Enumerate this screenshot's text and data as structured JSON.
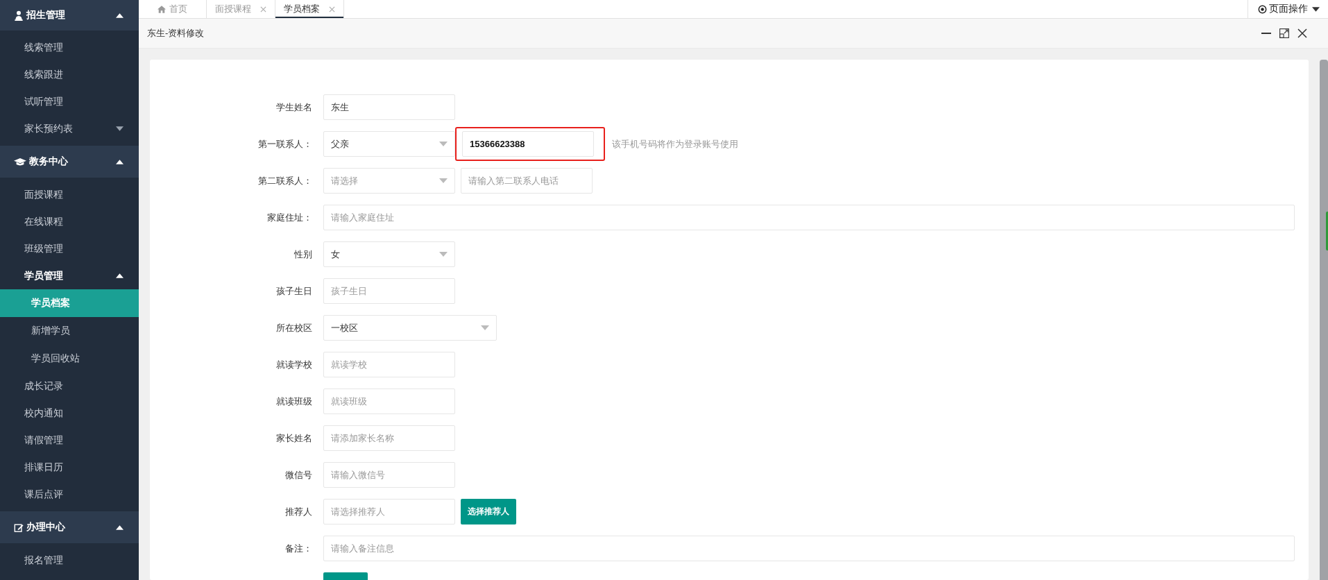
{
  "sidebar": {
    "groups": [
      {
        "label": "招生管理",
        "expanded": true,
        "items": [
          {
            "label": "线索管理",
            "kind": "link",
            "selected": false
          },
          {
            "label": "线索跟进",
            "kind": "link",
            "selected": false
          },
          {
            "label": "试听管理",
            "kind": "link",
            "selected": false
          },
          {
            "label": "家长预约表",
            "kind": "folder",
            "expanded": false,
            "selected": false
          }
        ]
      },
      {
        "label": "教务中心",
        "expanded": true,
        "items": [
          {
            "label": "面授课程",
            "kind": "link",
            "selected": false
          },
          {
            "label": "在线课程",
            "kind": "link",
            "selected": false
          },
          {
            "label": "班级管理",
            "kind": "link",
            "selected": false
          },
          {
            "label": "学员管理",
            "kind": "folder",
            "expanded": true,
            "selected": false,
            "children": [
              {
                "label": "学员档案",
                "selected": true
              },
              {
                "label": "新增学员",
                "selected": false
              },
              {
                "label": "学员回收站",
                "selected": false
              }
            ]
          },
          {
            "label": "成长记录",
            "kind": "link",
            "selected": false
          },
          {
            "label": "校内通知",
            "kind": "link",
            "selected": false
          },
          {
            "label": "请假管理",
            "kind": "link",
            "selected": false
          },
          {
            "label": "排课日历",
            "kind": "link",
            "selected": false
          },
          {
            "label": "课后点评",
            "kind": "link",
            "selected": false
          }
        ]
      },
      {
        "label": "办理中心",
        "expanded": true,
        "items": [
          {
            "label": "报名管理",
            "kind": "link",
            "selected": false
          }
        ]
      }
    ]
  },
  "tabs": [
    {
      "label": "首页",
      "kind": "home",
      "selected": false
    },
    {
      "label": "面授课程",
      "kind": "page",
      "selected": false
    },
    {
      "label": "学员档案",
      "kind": "page",
      "selected": true
    }
  ],
  "page_actions": {
    "label": "页面操作"
  },
  "panel": {
    "title": "东生-资料修改"
  },
  "form": {
    "rows": [
      {
        "label": "学生姓名",
        "controls": [
          {
            "kind": "input",
            "value": "东生"
          }
        ]
      },
      {
        "label": "第一联系人：",
        "controls": [
          {
            "kind": "select",
            "value": "父亲"
          },
          {
            "kind": "input",
            "value": "15366623388",
            "highlighted": true
          },
          {
            "kind": "hint",
            "text": "该手机号码将作为登录账号使用"
          }
        ]
      },
      {
        "label": "第二联系人：",
        "controls": [
          {
            "kind": "select",
            "placeholder": "请选择"
          },
          {
            "kind": "input",
            "placeholder": "请输入第二联系人电话"
          }
        ]
      },
      {
        "label": "家庭住址：",
        "controls": [
          {
            "kind": "wide-input",
            "placeholder": "请输入家庭住址"
          }
        ]
      },
      {
        "label": "性别",
        "controls": [
          {
            "kind": "select",
            "value": "女"
          }
        ]
      },
      {
        "label": "孩子生日",
        "controls": [
          {
            "kind": "input",
            "placeholder": "孩子生日"
          }
        ]
      },
      {
        "label": "所在校区",
        "controls": [
          {
            "kind": "wide-select",
            "value": "一校区"
          }
        ]
      },
      {
        "label": "就读学校",
        "controls": [
          {
            "kind": "input",
            "placeholder": "就读学校"
          }
        ]
      },
      {
        "label": "就读班级",
        "controls": [
          {
            "kind": "input",
            "placeholder": "就读班级"
          }
        ]
      },
      {
        "label": "家长姓名",
        "controls": [
          {
            "kind": "input",
            "placeholder": "请添加家长名称"
          }
        ]
      },
      {
        "label": "微信号",
        "controls": [
          {
            "kind": "input",
            "placeholder": "请输入微信号"
          }
        ]
      },
      {
        "label": "推荐人",
        "controls": [
          {
            "kind": "input",
            "placeholder": "请选择推荐人"
          },
          {
            "kind": "button",
            "label": "选择推荐人"
          }
        ]
      },
      {
        "label": "备注：",
        "controls": [
          {
            "kind": "wide-input",
            "placeholder": "请输入备注信息"
          }
        ]
      }
    ]
  }
}
